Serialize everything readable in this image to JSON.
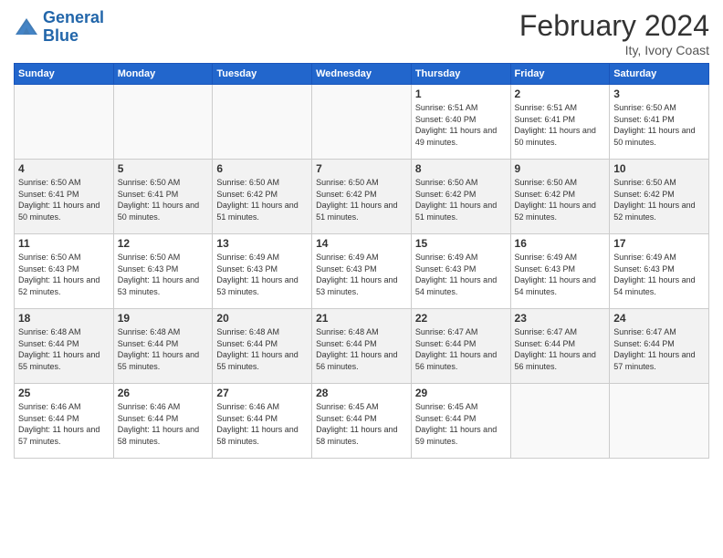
{
  "header": {
    "logo_line1": "General",
    "logo_line2": "Blue",
    "month_year": "February 2024",
    "location": "Ity, Ivory Coast"
  },
  "days_of_week": [
    "Sunday",
    "Monday",
    "Tuesday",
    "Wednesday",
    "Thursday",
    "Friday",
    "Saturday"
  ],
  "weeks": [
    [
      {
        "day": "",
        "info": ""
      },
      {
        "day": "",
        "info": ""
      },
      {
        "day": "",
        "info": ""
      },
      {
        "day": "",
        "info": ""
      },
      {
        "day": "1",
        "info": "Sunrise: 6:51 AM\nSunset: 6:40 PM\nDaylight: 11 hours\nand 49 minutes."
      },
      {
        "day": "2",
        "info": "Sunrise: 6:51 AM\nSunset: 6:41 PM\nDaylight: 11 hours\nand 50 minutes."
      },
      {
        "day": "3",
        "info": "Sunrise: 6:50 AM\nSunset: 6:41 PM\nDaylight: 11 hours\nand 50 minutes."
      }
    ],
    [
      {
        "day": "4",
        "info": "Sunrise: 6:50 AM\nSunset: 6:41 PM\nDaylight: 11 hours\nand 50 minutes."
      },
      {
        "day": "5",
        "info": "Sunrise: 6:50 AM\nSunset: 6:41 PM\nDaylight: 11 hours\nand 50 minutes."
      },
      {
        "day": "6",
        "info": "Sunrise: 6:50 AM\nSunset: 6:42 PM\nDaylight: 11 hours\nand 51 minutes."
      },
      {
        "day": "7",
        "info": "Sunrise: 6:50 AM\nSunset: 6:42 PM\nDaylight: 11 hours\nand 51 minutes."
      },
      {
        "day": "8",
        "info": "Sunrise: 6:50 AM\nSunset: 6:42 PM\nDaylight: 11 hours\nand 51 minutes."
      },
      {
        "day": "9",
        "info": "Sunrise: 6:50 AM\nSunset: 6:42 PM\nDaylight: 11 hours\nand 52 minutes."
      },
      {
        "day": "10",
        "info": "Sunrise: 6:50 AM\nSunset: 6:42 PM\nDaylight: 11 hours\nand 52 minutes."
      }
    ],
    [
      {
        "day": "11",
        "info": "Sunrise: 6:50 AM\nSunset: 6:43 PM\nDaylight: 11 hours\nand 52 minutes."
      },
      {
        "day": "12",
        "info": "Sunrise: 6:50 AM\nSunset: 6:43 PM\nDaylight: 11 hours\nand 53 minutes."
      },
      {
        "day": "13",
        "info": "Sunrise: 6:49 AM\nSunset: 6:43 PM\nDaylight: 11 hours\nand 53 minutes."
      },
      {
        "day": "14",
        "info": "Sunrise: 6:49 AM\nSunset: 6:43 PM\nDaylight: 11 hours\nand 53 minutes."
      },
      {
        "day": "15",
        "info": "Sunrise: 6:49 AM\nSunset: 6:43 PM\nDaylight: 11 hours\nand 54 minutes."
      },
      {
        "day": "16",
        "info": "Sunrise: 6:49 AM\nSunset: 6:43 PM\nDaylight: 11 hours\nand 54 minutes."
      },
      {
        "day": "17",
        "info": "Sunrise: 6:49 AM\nSunset: 6:43 PM\nDaylight: 11 hours\nand 54 minutes."
      }
    ],
    [
      {
        "day": "18",
        "info": "Sunrise: 6:48 AM\nSunset: 6:44 PM\nDaylight: 11 hours\nand 55 minutes."
      },
      {
        "day": "19",
        "info": "Sunrise: 6:48 AM\nSunset: 6:44 PM\nDaylight: 11 hours\nand 55 minutes."
      },
      {
        "day": "20",
        "info": "Sunrise: 6:48 AM\nSunset: 6:44 PM\nDaylight: 11 hours\nand 55 minutes."
      },
      {
        "day": "21",
        "info": "Sunrise: 6:48 AM\nSunset: 6:44 PM\nDaylight: 11 hours\nand 56 minutes."
      },
      {
        "day": "22",
        "info": "Sunrise: 6:47 AM\nSunset: 6:44 PM\nDaylight: 11 hours\nand 56 minutes."
      },
      {
        "day": "23",
        "info": "Sunrise: 6:47 AM\nSunset: 6:44 PM\nDaylight: 11 hours\nand 56 minutes."
      },
      {
        "day": "24",
        "info": "Sunrise: 6:47 AM\nSunset: 6:44 PM\nDaylight: 11 hours\nand 57 minutes."
      }
    ],
    [
      {
        "day": "25",
        "info": "Sunrise: 6:46 AM\nSunset: 6:44 PM\nDaylight: 11 hours\nand 57 minutes."
      },
      {
        "day": "26",
        "info": "Sunrise: 6:46 AM\nSunset: 6:44 PM\nDaylight: 11 hours\nand 58 minutes."
      },
      {
        "day": "27",
        "info": "Sunrise: 6:46 AM\nSunset: 6:44 PM\nDaylight: 11 hours\nand 58 minutes."
      },
      {
        "day": "28",
        "info": "Sunrise: 6:45 AM\nSunset: 6:44 PM\nDaylight: 11 hours\nand 58 minutes."
      },
      {
        "day": "29",
        "info": "Sunrise: 6:45 AM\nSunset: 6:44 PM\nDaylight: 11 hours\nand 59 minutes."
      },
      {
        "day": "",
        "info": ""
      },
      {
        "day": "",
        "info": ""
      }
    ]
  ]
}
